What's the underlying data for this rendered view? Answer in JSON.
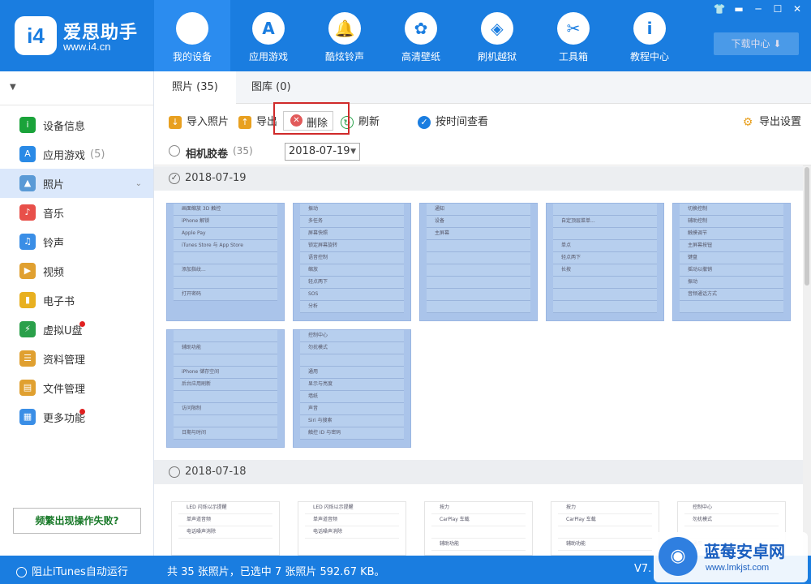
{
  "app": {
    "brand_name": "爱思助手",
    "brand_url": "www.i4.cn",
    "logo_text": "i4"
  },
  "nav": [
    {
      "label": "我的设备",
      "icon": "apple-icon",
      "glyph": ""
    },
    {
      "label": "应用游戏",
      "icon": "app-store-icon",
      "glyph": "A"
    },
    {
      "label": "酷炫铃声",
      "icon": "bell-icon",
      "glyph": "🔔"
    },
    {
      "label": "高清壁纸",
      "icon": "flower-icon",
      "glyph": "✿"
    },
    {
      "label": "刷机越狱",
      "icon": "dropbox-icon",
      "glyph": "◈"
    },
    {
      "label": "工具箱",
      "icon": "tools-icon",
      "glyph": "✂"
    },
    {
      "label": "教程中心",
      "icon": "info-icon",
      "glyph": "i"
    }
  ],
  "window_controls": [
    "👕",
    "▬",
    "─",
    "☐",
    "✕"
  ],
  "download_center": "下载中心",
  "sidebar": {
    "items": [
      {
        "label": "设备信息",
        "icon": "info-icon",
        "color": "#1aa33a",
        "glyph": "i"
      },
      {
        "label": "应用游戏",
        "icon": "app-store-icon",
        "color": "#2a8ae6",
        "glyph": "A",
        "count": "(5)"
      },
      {
        "label": "照片",
        "icon": "photo-icon",
        "color": "#5a9ad6",
        "glyph": "▲"
      },
      {
        "label": "音乐",
        "icon": "music-icon",
        "color": "#e8504a",
        "glyph": "♪"
      },
      {
        "label": "铃声",
        "icon": "bell-icon",
        "color": "#3a8ee6",
        "glyph": "♫"
      },
      {
        "label": "视频",
        "icon": "video-icon",
        "color": "#e0a030",
        "glyph": "▶"
      },
      {
        "label": "电子书",
        "icon": "book-icon",
        "color": "#e8b020",
        "glyph": "▮"
      },
      {
        "label": "虚拟U盘",
        "icon": "usb-icon",
        "color": "#2aa04a",
        "glyph": "⚡"
      },
      {
        "label": "资料管理",
        "icon": "contacts-icon",
        "color": "#e0a030",
        "glyph": "☰"
      },
      {
        "label": "文件管理",
        "icon": "file-icon",
        "color": "#e0a030",
        "glyph": "▤"
      },
      {
        "label": "更多功能",
        "icon": "grid-icon",
        "color": "#3a8ee6",
        "glyph": "▦"
      }
    ],
    "help_button": "频繁出现操作失败?"
  },
  "tabs": [
    {
      "label": "照片 (35)"
    },
    {
      "label": "图库 (0)"
    }
  ],
  "toolbar": {
    "import": "导入照片",
    "export": "导出",
    "delete": "删除",
    "refresh": "刷新",
    "by_time": "按时间查看",
    "export_settings": "导出设置"
  },
  "filter": {
    "album": "相机胶卷",
    "album_count": "(35)",
    "date_value": "2018-07-19"
  },
  "groups": [
    {
      "date": "2018-07-19"
    },
    {
      "date": "2018-07-18"
    }
  ],
  "thumbs_group1": [
    [
      "画面缩放 3D 触控",
      "iPhone 解锁",
      "Apple Pay",
      "iTunes Store 与 App Store",
      "",
      "添加指纹...",
      "",
      "打开密码"
    ],
    [
      "振动",
      "多任务",
      "屏幕快照",
      "锁定屏幕旋转",
      "语音控制",
      "缩放",
      "轻点两下",
      "SOS",
      "分析"
    ],
    [
      "通知",
      "设备",
      "主屏幕",
      "",
      "",
      "",
      "",
      "",
      ""
    ],
    [
      "",
      "自定顶层菜单...",
      "",
      "单点",
      "轻点两下",
      "长按",
      "",
      "",
      ""
    ],
    [
      "切换控制",
      "辅助控制",
      "触摸调节",
      "主屏幕按钮",
      "键盘",
      "摇动以撤销",
      "振动",
      "音频通话方式",
      ""
    ],
    [
      "",
      "辅助功能",
      "",
      "iPhone 储存空间",
      "后台应用刷新",
      "",
      "访问限制",
      "",
      "日期与时间"
    ],
    [
      "控制中心",
      "勿扰模式",
      "",
      "通用",
      "显示与亮度",
      "墙纸",
      "声音",
      "Siri 与搜索",
      "触控 ID 与密码"
    ]
  ],
  "thumbs_group2": [
    [
      "LED 闪烁以示提醒",
      "单声道音频",
      "电话噪声消除"
    ],
    [
      "LED 闪烁以示提醒",
      "单声道音频",
      "电话噪声消除"
    ],
    [
      "按力",
      "CarPlay 车载",
      "",
      "辅助功能"
    ],
    [
      "按力",
      "CarPlay 车载",
      "",
      "辅助功能"
    ],
    [
      "控制中心",
      "勿扰模式",
      "",
      "通用"
    ]
  ],
  "status": {
    "itunes": "阻止iTunes自动运行",
    "summary": "共 35 张照片，已选中 7 张照片 592.67 KB。",
    "version": "V7."
  },
  "watermark": {
    "title": "蓝莓安卓网",
    "url": "www.lmkjst.com"
  },
  "colors": {
    "primary": "#1a7de0",
    "selected_photo": "#aac4ea",
    "highlight_box": "#d02a2a"
  }
}
